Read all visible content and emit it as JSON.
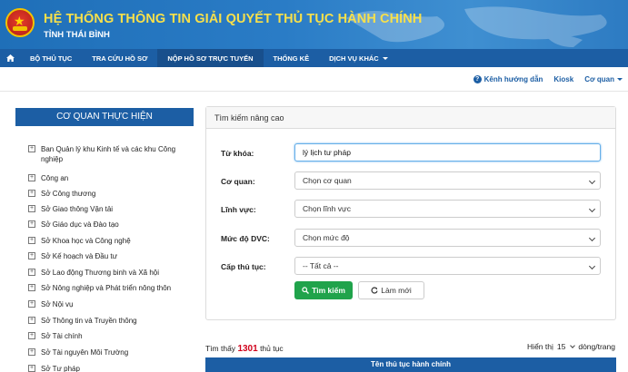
{
  "header": {
    "title": "HỆ THỐNG THÔNG TIN GIẢI QUYẾT THỦ TỤC HÀNH CHÍNH",
    "subtitle": "TỈNH THÁI BÌNH"
  },
  "nav": {
    "items": [
      {
        "label": "BỘ THỦ TỤC"
      },
      {
        "label": "TRA CỨU HỒ SƠ"
      },
      {
        "label": "NỘP HỒ SƠ TRỰC TUYẾN"
      },
      {
        "label": "THỐNG KÊ"
      },
      {
        "label": "DỊCH VỤ KHÁC"
      }
    ]
  },
  "utility": {
    "help": "Kênh hướng dẫn",
    "kiosk": "Kiosk",
    "agency": "Cơ quan"
  },
  "sidebar": {
    "title": "CƠ QUAN THỰC HIỆN",
    "items": [
      {
        "label": "Ban Quản lý khu Kinh tế và các khu Công nghiệp"
      },
      {
        "label": "Công an"
      },
      {
        "label": "Sở Công thương"
      },
      {
        "label": "Sở Giao thông Vận tải"
      },
      {
        "label": "Sở Giáo dục và Đào tạo"
      },
      {
        "label": "Sở Khoa học và Công nghệ"
      },
      {
        "label": "Sở Kế hoạch và Đầu tư"
      },
      {
        "label": "Sở Lao động Thương binh và Xã hội"
      },
      {
        "label": "Sở Nông nghiệp và Phát triển nông thôn"
      },
      {
        "label": "Sở Nội vụ"
      },
      {
        "label": "Sở Thông tin và Truyền thông"
      },
      {
        "label": "Sở Tài chính"
      },
      {
        "label": "Sở Tài nguyên Môi Trường"
      },
      {
        "label": "Sở Tư pháp"
      }
    ]
  },
  "search": {
    "heading": "Tìm kiếm nâng cao",
    "keyword_label": "Từ khóa:",
    "keyword_value": "lý lịch tư pháp",
    "agency_label": "Cơ quan:",
    "agency_value": "Chọn cơ quan",
    "field_label": "Lĩnh vực:",
    "field_value": "Chọn lĩnh vực",
    "level_label": "Mức độ DVC:",
    "level_value": "Chọn mức độ",
    "tier_label": "Cấp thủ tục:",
    "tier_value": "-- Tất cả --",
    "search_button": "Tìm kiếm",
    "reset_button": "Làm mới"
  },
  "results": {
    "found_prefix": "Tìm thấy",
    "count": "1301",
    "found_suffix": "thủ tục",
    "show_label": "Hiển thị",
    "per_page": "15",
    "per_page_suffix": "dòng/trang",
    "column_name": "Tên thủ tục hành chính"
  },
  "colors": {
    "brand_blue": "#1c5ea4",
    "title_yellow": "#f7e04b",
    "search_green": "#20a34b",
    "count_red": "#d0021b"
  }
}
